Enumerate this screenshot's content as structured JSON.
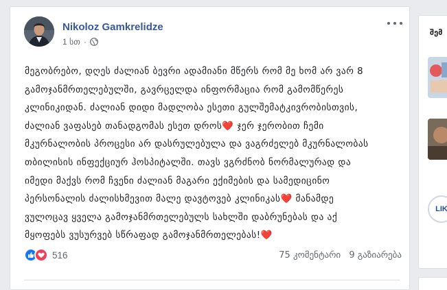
{
  "post": {
    "author": "Nikoloz Gamkrelidze",
    "time": "1 სთ",
    "privacy_icon": "globe-icon",
    "text_lines": [
      "მეგობრებო, დღეს ძალიან ბევრი ადამიანი მწერს რომ მე ხომ არ ვარ 8",
      "გამოჯანმრთელებულში, გავრცელდა ინფორმაცია რომ გამომწერეს",
      "კლინიკიდან. ძალიან დიდი მადლობა ესეთი გულშემატკივრობისთვის,",
      "ძალიან ვაფასებ თანადგომას ესეთ დროს",
      " ჯერ ჯერობით ჩემი",
      "მკურნალობის პროცესი არ დასრულებულა და ვაგრძელებ მკურნალობას",
      "თბილისის ინფექციურ ჰოსპიტალში. თავს ვგრძნობ ნორმალურად და",
      "იმედი მაქვს რომ ჩვენი ძალიან მაგარი ექიმების და სამედიცინო",
      "პერსონალის ძალისხმევით მალე დავტოვებ კლინიკას",
      " მანამდე",
      "ვულოცავ ყველა გამოჯანმრთელებულს სახლში დაბრუნებას და აქ",
      "მყოფებს ვუსურვებ სწრაფად გამოჯანმრთელებას!"
    ],
    "heart_emoji": "❤️"
  },
  "reactions": {
    "count": "516",
    "types": [
      "like-icon",
      "love-icon"
    ]
  },
  "stats": {
    "comments": "75 კომენტარი",
    "shares": "9 გაზიარება"
  },
  "side": {
    "header": "შემ",
    "logo_text": "LIK"
  },
  "colors": {
    "author": "#385898",
    "like": "#1877f2",
    "love": "#f33e58",
    "heart": "#e0245e"
  }
}
